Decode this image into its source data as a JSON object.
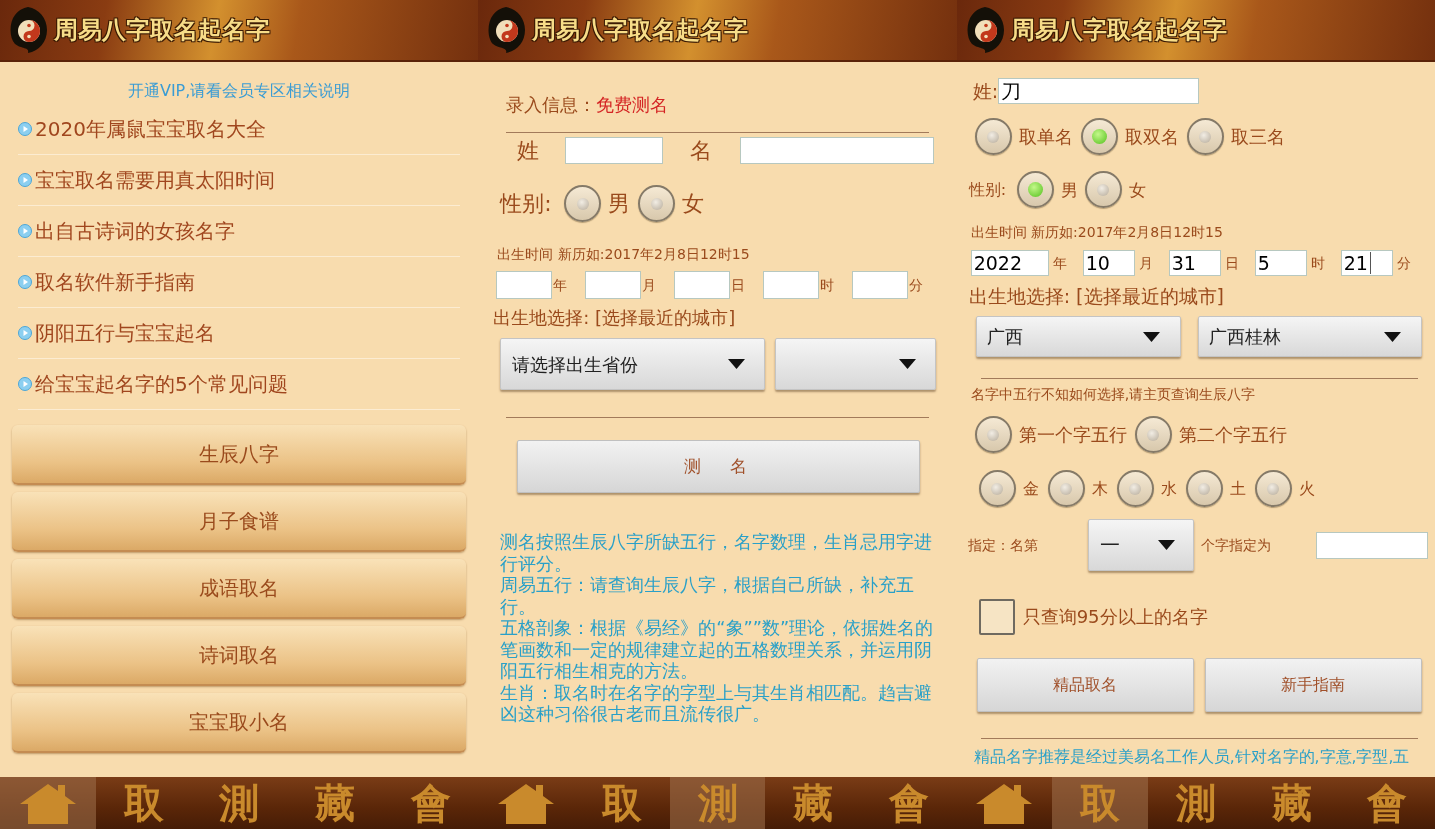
{
  "screens": [
    {
      "kind": "home",
      "header": {
        "title": "周易八字取名起名字"
      },
      "vip_notice": "开通VIP,请看会员专区相关说明",
      "articles": [
        "2020年属鼠宝宝取名大全",
        "宝宝取名需要用真太阳时间",
        "出自古诗词的女孩名字",
        "取名软件新手指南",
        "阴阳五行与宝宝起名",
        "给宝宝起名字的5个常见问题"
      ],
      "menu_buttons": [
        "生辰八字",
        "月子食谱",
        "成语取名",
        "诗词取名",
        "宝宝取小名"
      ],
      "tab_bar": [
        {
          "kind": "home",
          "selected": true
        },
        {
          "kind": "text",
          "label": "取",
          "selected": false
        },
        {
          "kind": "text",
          "label": "測",
          "selected": false
        },
        {
          "kind": "text",
          "label": "藏",
          "selected": false
        },
        {
          "kind": "text",
          "label": "會",
          "selected": false
        }
      ]
    },
    {
      "kind": "name_test",
      "header": {
        "title": "周易八字取名起名字"
      },
      "section_label": "录入信息：",
      "section_value": "免费测名",
      "surname": {
        "label": "姓"
      },
      "given_name": {
        "label": "名"
      },
      "gender": {
        "label": "性别:",
        "options": [
          {
            "label": "男",
            "selected": false
          },
          {
            "label": "女",
            "selected": false
          }
        ]
      },
      "birth_time_hint": "出生时间 新历如:2017年2月8日12时15",
      "birth_time_fields": [
        {
          "unit": "年"
        },
        {
          "unit": "月"
        },
        {
          "unit": "日"
        },
        {
          "unit": "时"
        },
        {
          "unit": "分"
        }
      ],
      "birthplace_label": "出生地选择: [选择最近的城市]",
      "birthplace_selects": [
        {
          "value": "请选择出生省份"
        }
      ],
      "submit_button": "测　名",
      "description": [
        "测名按照生辰八字所缺五行，名字数理，生肖忌用字进行评分。",
        "周易五行：请查询生辰八字，根据自己所缺，补充五行。",
        "五格剖象：根据《易经》的“象””数”理论，依据姓名的笔画数和一定的规律建立起的五格数理关系，并运用阴阳五行相生相克的方法。",
        "生肖：取名时在名字的字型上与其生肖相匹配。趋吉避凶这种习俗很古老而且流传很广。"
      ],
      "tab_bar": [
        {
          "kind": "home",
          "selected": false
        },
        {
          "kind": "text",
          "label": "取",
          "selected": false
        },
        {
          "kind": "text",
          "label": "測",
          "selected": true
        },
        {
          "kind": "text",
          "label": "藏",
          "selected": false
        },
        {
          "kind": "text",
          "label": "會",
          "selected": false
        }
      ]
    },
    {
      "kind": "name_picker",
      "header": {
        "title": "周易八字取名起名字"
      },
      "surname": {
        "label": "姓:",
        "value": "刀"
      },
      "name_length": [
        {
          "label": "取单名",
          "selected": false
        },
        {
          "label": "取双名",
          "selected": true
        },
        {
          "label": "取三名",
          "selected": false
        }
      ],
      "gender": {
        "label": "性别:",
        "options": [
          {
            "label": "男",
            "selected": true
          },
          {
            "label": "女",
            "selected": false
          }
        ]
      },
      "birth_time_hint": "出生时间 新历如:2017年2月8日12时15",
      "birth_time_fields": [
        {
          "value": "2022",
          "unit": "年",
          "focused": false
        },
        {
          "value": "10",
          "unit": "月",
          "focused": false
        },
        {
          "value": "31",
          "unit": "日",
          "focused": false
        },
        {
          "value": "5",
          "unit": "时",
          "focused": false
        },
        {
          "value": "21",
          "unit": "分",
          "focused": true
        }
      ],
      "birthplace_label": "出生地选择: [选择最近的城市]",
      "birthplace_selects": [
        {
          "value": "广西"
        },
        {
          "value": "广西桂林"
        }
      ],
      "element_hint": "名字中五行不知如何选择,请主页查询生辰八字",
      "element_position": [
        {
          "label": "第一个字五行",
          "selected": false
        },
        {
          "label": "第二个字五行",
          "selected": false
        }
      ],
      "elements": [
        {
          "label": "金",
          "selected": false
        },
        {
          "label": "木",
          "selected": false
        },
        {
          "label": "水",
          "selected": false
        },
        {
          "label": "土",
          "selected": false
        },
        {
          "label": "火",
          "selected": false
        }
      ],
      "designate": {
        "prefix": "指定：名第",
        "select_value": "一",
        "suffix": "个字指定为"
      },
      "high_score_only": {
        "label": "只查询95分以上的名字",
        "checked": false
      },
      "buttons": [
        "精品取名",
        "新手指南"
      ],
      "footnote": "精品名字推荐是经过美易名工作人员,针对名字的,字意,字型,五",
      "tab_bar": [
        {
          "kind": "home",
          "selected": false
        },
        {
          "kind": "text",
          "label": "取",
          "selected": true
        },
        {
          "kind": "text",
          "label": "測",
          "selected": false
        },
        {
          "kind": "text",
          "label": "藏",
          "selected": false
        },
        {
          "kind": "text",
          "label": "會",
          "selected": false
        }
      ]
    }
  ]
}
